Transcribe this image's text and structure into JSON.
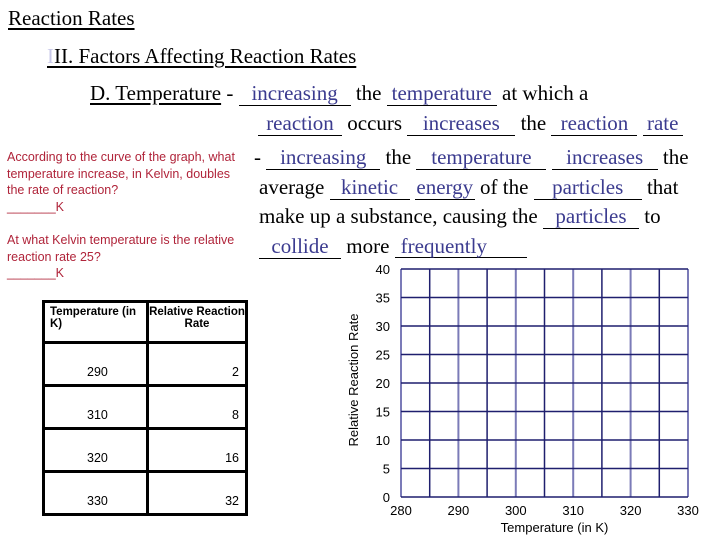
{
  "title": "Reaction Rates",
  "section": {
    "prefix": "I",
    "rest": "II.  Factors Affecting Reaction Rates"
  },
  "subsection": {
    "heading": "D.  Temperature",
    "line1": {
      "dash": " - ",
      "blank1": "increasing",
      "t1": " the ",
      "blank2": "temperature",
      "t2": " at which a"
    },
    "line2": {
      "blank1": "reaction",
      "t1": " occurs ",
      "blank2": "increases",
      "t2": " the ",
      "blank3": "reaction",
      "blank4": "rate"
    },
    "line3": {
      "dash": "- ",
      "blank1": "increasing",
      "t1": " the ",
      "blank2": "temperature",
      "blank3": "increases",
      "t2": " the"
    },
    "line4": {
      "t1": "average ",
      "blank1": "kinetic",
      "blank2": "energy",
      "t2": " of the ",
      "blank3": "particles",
      "t3": " that"
    },
    "line5": {
      "t1": "make up a substance, causing the ",
      "blank1": "particles",
      "t2": " to"
    },
    "line6": {
      "blank1": "collide",
      "t1": " more ",
      "blank2": "frequently"
    }
  },
  "questions": [
    {
      "text": "According to the curve of the graph, what temperature increase, in Kelvin, doubles the rate of reaction?",
      "answer_blank": "_______K"
    },
    {
      "text": "At what Kelvin temperature is the relative reaction rate 25?",
      "answer_blank": "_______K"
    }
  ],
  "table": {
    "headers": [
      "Temperature (in K)",
      "Relative Reaction Rate"
    ],
    "rows": [
      [
        "290",
        "2"
      ],
      [
        "310",
        "8"
      ],
      [
        "320",
        "16"
      ],
      [
        "330",
        "32"
      ]
    ]
  },
  "chart_data": {
    "type": "scatter",
    "title": "",
    "xlabel": "Temperature (in K)",
    "ylabel": "Relative Reaction Rate",
    "xlim": [
      280,
      330
    ],
    "ylim": [
      0,
      40
    ],
    "x_ticks": [
      "280",
      "290",
      "300",
      "310",
      "320",
      "330"
    ],
    "y_ticks": [
      "0",
      "5",
      "10",
      "15",
      "20",
      "25",
      "30",
      "35",
      "40"
    ],
    "x_grid_step": 5,
    "y_grid_step": 5,
    "grid": true,
    "grid_color": "#1f1f6e",
    "series": []
  }
}
